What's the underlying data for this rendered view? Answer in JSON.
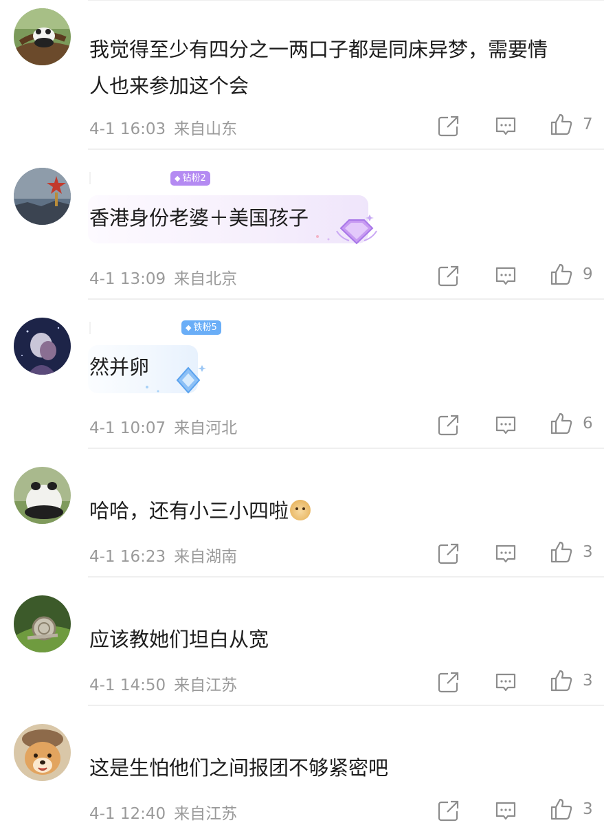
{
  "comments": [
    {
      "avatar": "panda-in-tree-avatar",
      "line1": "我觉得至少有四分之一两口子都是同床异梦，需要情",
      "line2": "人也来参加这个会",
      "time": "4-1 16:03",
      "location": "来自山东",
      "likes": "7"
    },
    {
      "avatar": "kremlin-star-avatar",
      "badge": "钻粉2",
      "text": "香港身份老婆＋美国孩子",
      "time": "4-1 13:09",
      "location": "来自北京",
      "likes": "9"
    },
    {
      "avatar": "anime-couple-avatar",
      "badge": "铁粉5",
      "text": "然并卵",
      "time": "4-1 10:07",
      "location": "来自河北",
      "likes": "6"
    },
    {
      "avatar": "panda-back-avatar",
      "text": "哈哈，还有小三小四啦",
      "emoji": "doge-emoji",
      "time": "4-1 16:23",
      "location": "来自湖南",
      "likes": "3"
    },
    {
      "avatar": "snail-avatar",
      "text": "应该教她们坦白从宽",
      "time": "4-1 14:50",
      "location": "来自江苏",
      "likes": "3"
    },
    {
      "avatar": "shiba-dog-avatar",
      "text": "这是生怕他们之间报团不够紧密吧",
      "time": "4-1 12:40",
      "location": "来自江苏",
      "likes": "3"
    }
  ],
  "icons": {
    "share": "share-icon",
    "comment": "comment-icon",
    "like": "thumbs-up-icon"
  },
  "colors": {
    "meta_gray": "#9a9a9a",
    "diamond_badge": "#b48af2",
    "iron_badge": "#6aaef7"
  }
}
